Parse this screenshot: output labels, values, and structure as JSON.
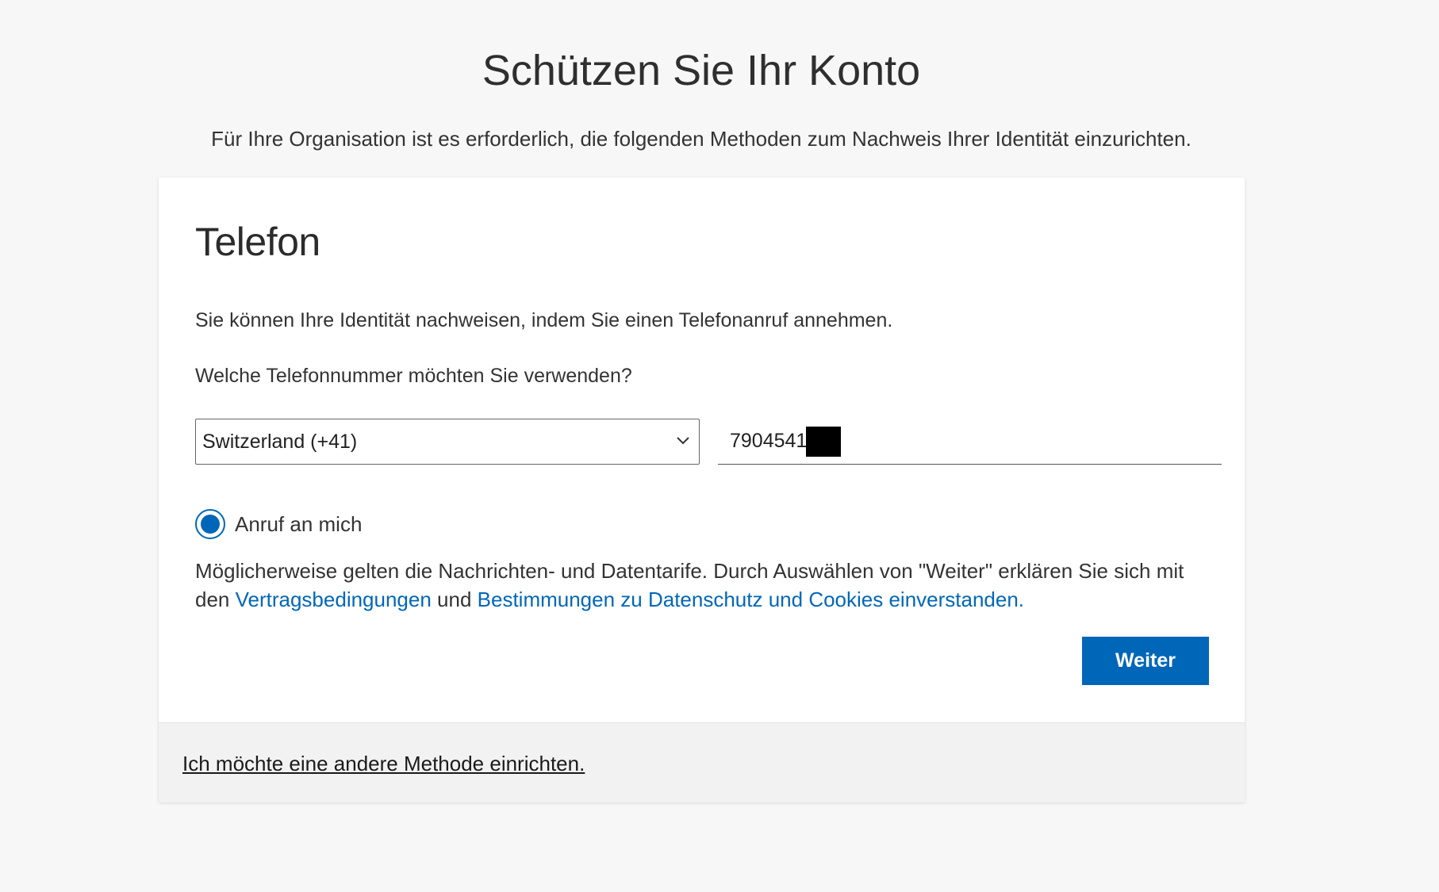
{
  "header": {
    "title": "Schützen Sie Ihr Konto",
    "subtitle": "Für Ihre Organisation ist es erforderlich, die folgenden Methoden zum Nachweis Ihrer Identität einzurichten."
  },
  "card": {
    "title": "Telefon",
    "description": "Sie können Ihre Identität nachweisen, indem Sie einen Telefonanruf annehmen.",
    "question": "Welche Telefonnummer möchten Sie verwenden?",
    "country_select": {
      "selected": "Switzerland (+41)",
      "icon": "chevron-down-icon"
    },
    "phone_input": {
      "value": "7904541"
    },
    "radio": {
      "label": "Anruf an mich",
      "checked": true
    },
    "terms": {
      "text_before": "Möglicherweise gelten die Nachrichten- und Datentarife. Durch Auswählen von \"Weiter\" erklären Sie sich mit den ",
      "link1": "Vertragsbedingungen",
      "text_middle": " und ",
      "link2": "Bestimmungen zu Datenschutz und Cookies einverstanden."
    },
    "next_button": "Weiter"
  },
  "footer": {
    "link": "Ich möchte eine andere Methode einrichten."
  },
  "colors": {
    "accent": "#0067b8",
    "background": "#f7f7f7",
    "card": "#ffffff",
    "footer": "#f2f2f2"
  }
}
